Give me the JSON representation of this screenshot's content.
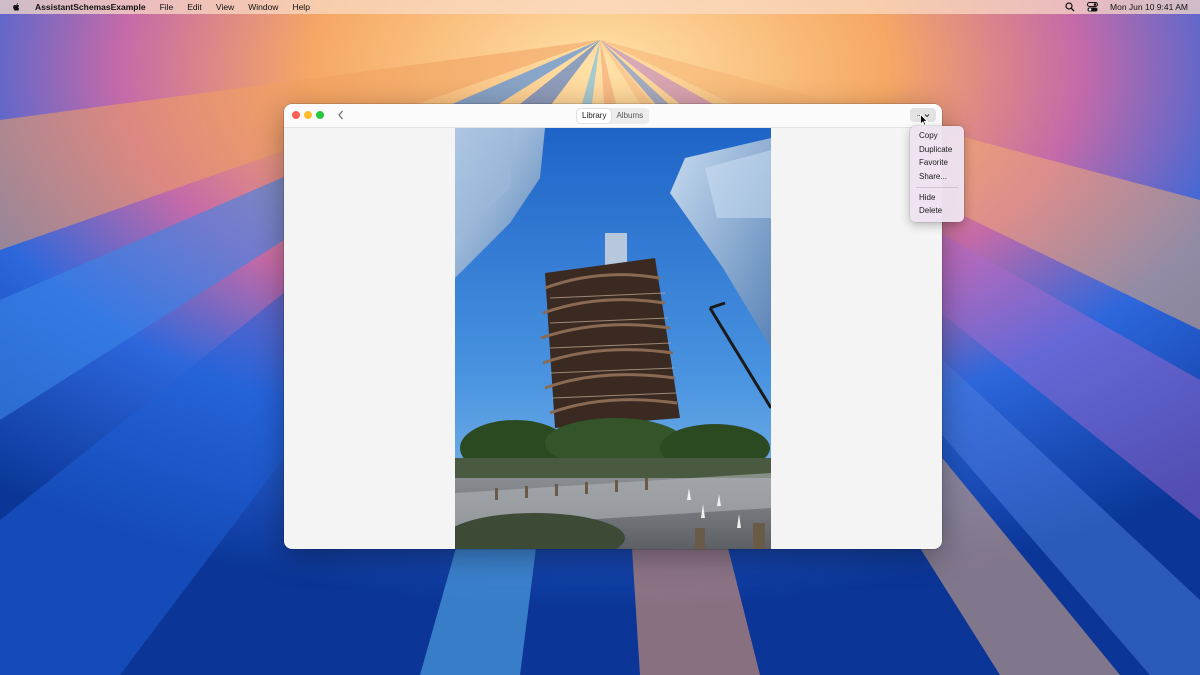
{
  "menubar": {
    "app_name": "AssistantSchemasExample",
    "menus": [
      "File",
      "Edit",
      "View",
      "Window",
      "Help"
    ],
    "clock": "Mon Jun 10  9:41 AM"
  },
  "window": {
    "segments": [
      {
        "label": "Library",
        "active": true
      },
      {
        "label": "Albums",
        "active": false
      }
    ],
    "more_button_label": "···"
  },
  "dropdown": {
    "group1": [
      "Copy",
      "Duplicate",
      "Favorite",
      "Share..."
    ],
    "group2": [
      "Hide",
      "Delete"
    ]
  },
  "colors": {
    "close": "#ff5f57",
    "minimize": "#febc2e",
    "maximize": "#28c840"
  }
}
